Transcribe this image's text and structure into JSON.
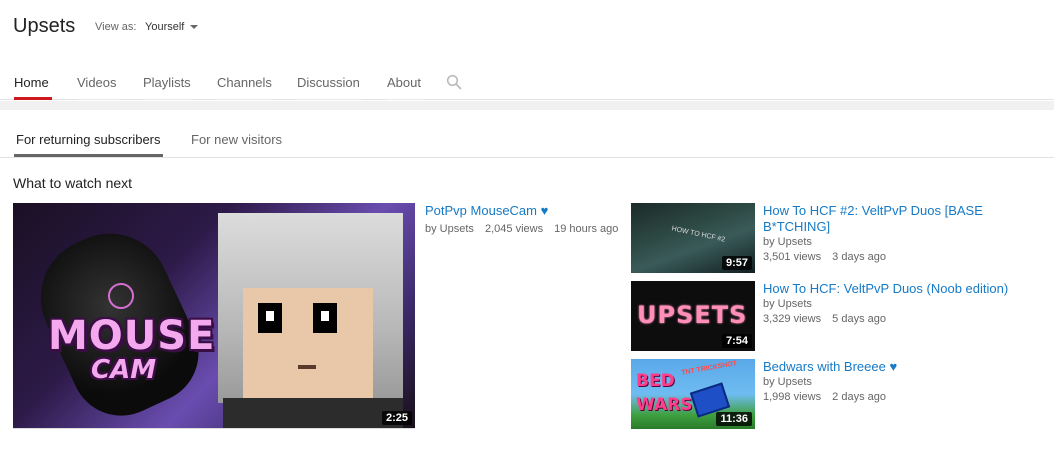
{
  "channel": {
    "title": "Upsets",
    "view_as_label": "View as:",
    "view_as_value": "Yourself"
  },
  "tabs": [
    {
      "label": "Home",
      "active": true
    },
    {
      "label": "Videos",
      "active": false
    },
    {
      "label": "Playlists",
      "active": false
    },
    {
      "label": "Channels",
      "active": false
    },
    {
      "label": "Discussion",
      "active": false
    },
    {
      "label": "About",
      "active": false
    }
  ],
  "subtabs": [
    {
      "label": "For returning subscribers",
      "active": true
    },
    {
      "label": "For new visitors",
      "active": false
    }
  ],
  "section": {
    "title": "What to watch next"
  },
  "featured": {
    "thumb_text_1": "MOUSE",
    "thumb_text_2": "CAM",
    "duration": "2:25",
    "title": "PotPvp MouseCam ♥",
    "author": "by Upsets",
    "views": "2,045 views",
    "age": "19 hours ago"
  },
  "videos": [
    {
      "title": "How To HCF #2: VeltPvP Duos [BASE B*TCHING]",
      "author": "by Upsets",
      "views": "3,501 views",
      "age": "3 days ago",
      "duration": "9:57",
      "thumb_text": "HOW TO HCF #2"
    },
    {
      "title": "How To HCF: VeltPvP Duos (Noob edition)",
      "author": "by Upsets",
      "views": "3,329 views",
      "age": "5 days ago",
      "duration": "7:54",
      "thumb_text": "UPSETS"
    },
    {
      "title": "Bedwars with Breeee ♥",
      "author": "by Upsets",
      "views": "1,998 views",
      "age": "2 days ago",
      "duration": "11:36",
      "thumb_text_1": "BED",
      "thumb_text_2": "WARS",
      "thumb_banner": "TNT TRICKSHOT"
    }
  ],
  "colors": {
    "accent_red": "#cc181e",
    "link_blue": "#167ac6"
  }
}
